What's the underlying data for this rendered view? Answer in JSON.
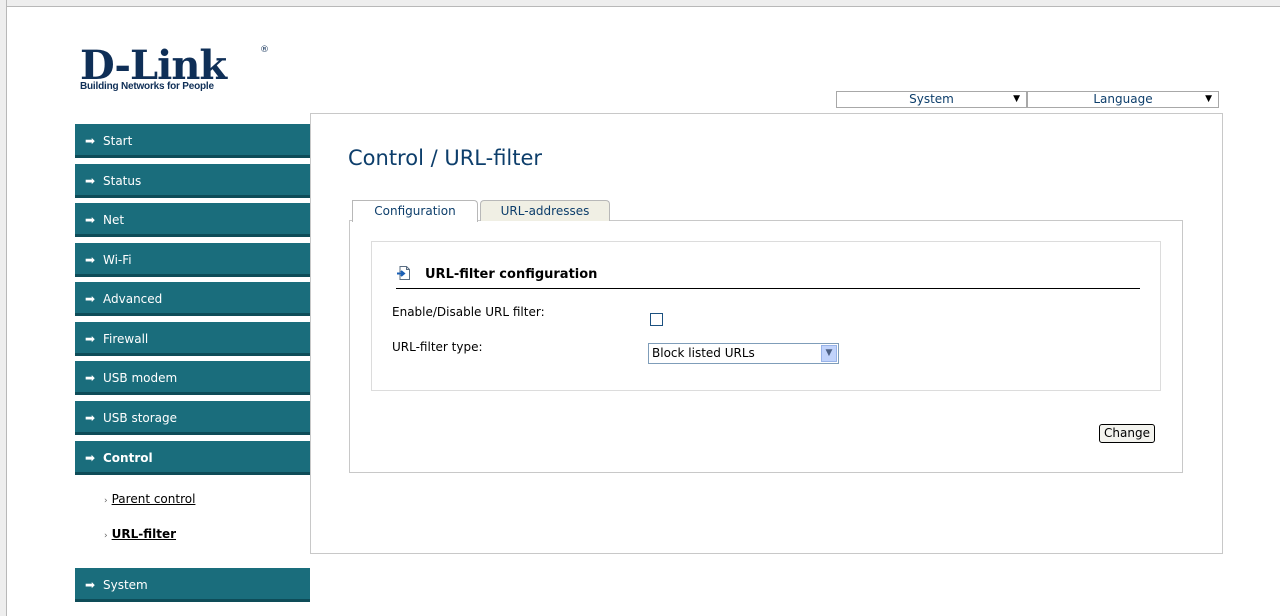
{
  "brand": {
    "logo": "D-Link",
    "registered": "®",
    "tagline": "Building Networks for People"
  },
  "topbar": {
    "system_label": "System",
    "language_label": "Language"
  },
  "menu": {
    "items": [
      {
        "label": "Start"
      },
      {
        "label": "Status"
      },
      {
        "label": "Net"
      },
      {
        "label": "Wi-Fi"
      },
      {
        "label": "Advanced"
      },
      {
        "label": "Firewall"
      },
      {
        "label": "USB modem"
      },
      {
        "label": "USB storage"
      },
      {
        "label": "Control"
      },
      {
        "label": "System"
      }
    ],
    "active": "Control",
    "submenu": [
      {
        "label": "Parent control"
      },
      {
        "label": "URL-filter"
      }
    ],
    "active_sub": "URL-filter"
  },
  "page": {
    "title": "Control / URL-filter"
  },
  "tabs": [
    {
      "label": "Configuration"
    },
    {
      "label": "URL-addresses"
    }
  ],
  "section": {
    "title": "URL-filter configuration",
    "enable_label": "Enable/Disable URL filter:",
    "enable_checked": false,
    "type_label": "URL-filter type:",
    "type_value": "Block listed URLs",
    "change_button": "Change"
  },
  "colors": {
    "menu_bg": "#1a6d7c",
    "title": "#0d3e6b",
    "logo": "#0f2f57"
  }
}
